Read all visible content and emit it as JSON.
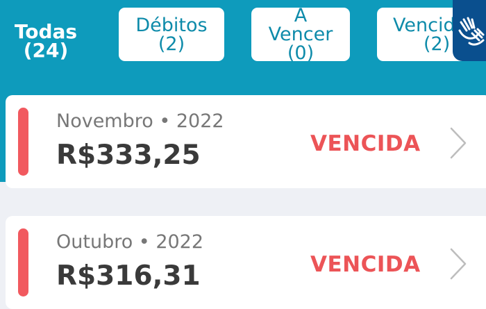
{
  "filters": [
    {
      "label": "Todas",
      "count": "(24)",
      "selected": true
    },
    {
      "label": "Débitos",
      "count": "(2)",
      "selected": false
    },
    {
      "label": "A\nVencer",
      "count": "(0)",
      "selected": false
    },
    {
      "label": "Vencidas",
      "count": "(2)",
      "selected": false
    }
  ],
  "accessibility": {
    "icon": "sign-language-hands-icon"
  },
  "invoices": [
    {
      "period": "Novembro • 2022",
      "amount": "R$333,25",
      "status": "VENCIDA"
    },
    {
      "period": "Outubro • 2022",
      "amount": "R$316,31",
      "status": "VENCIDA"
    }
  ],
  "colors": {
    "header": "#0E9BBC",
    "overdue": "#EC5457",
    "background": "#EEF0F5",
    "accessibility": "#0A4F8E"
  }
}
